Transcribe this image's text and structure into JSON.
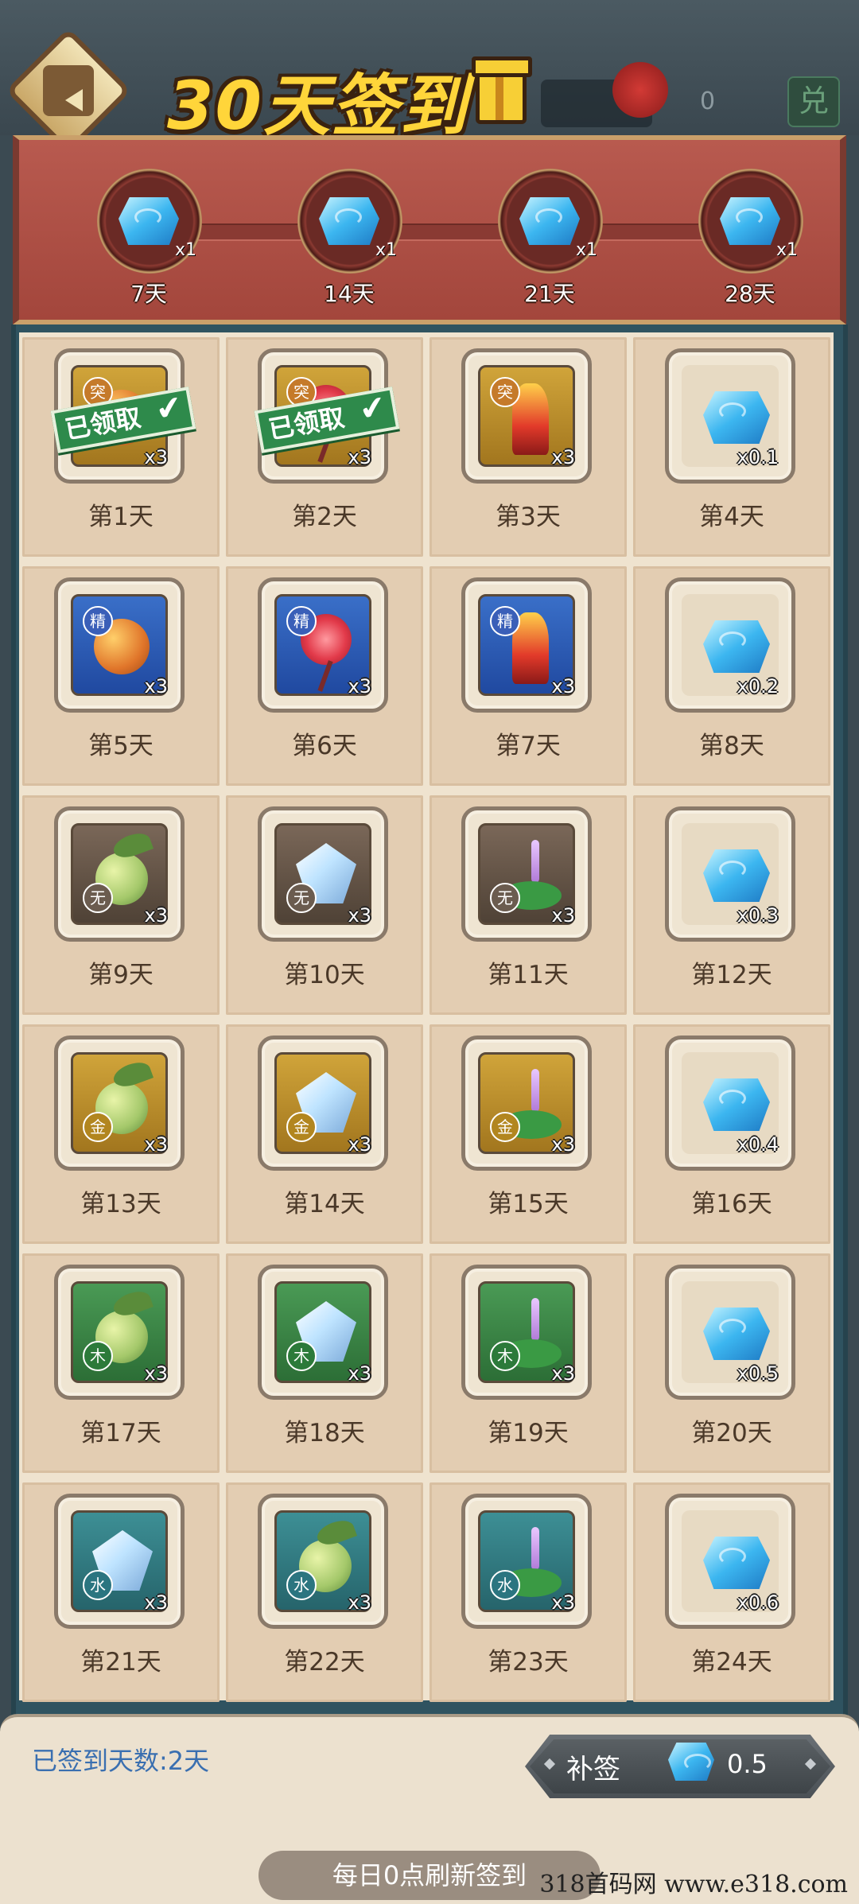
{
  "header": {
    "title": "30天签到",
    "currency_value": "0",
    "exchange_label": "兑"
  },
  "milestones": [
    {
      "count": "x1",
      "label": "7天",
      "icon": "blue-gem-icon"
    },
    {
      "count": "x1",
      "label": "14天",
      "icon": "blue-gem-icon"
    },
    {
      "count": "x1",
      "label": "21天",
      "icon": "blue-gem-icon"
    },
    {
      "count": "x1",
      "label": "28天",
      "icon": "blue-gem-icon"
    }
  ],
  "claimed_label": "已领取",
  "days": [
    {
      "label": "第1天",
      "qty": "x3",
      "bg": "gold",
      "badge": "突",
      "badge_pos": "top",
      "item": "orb",
      "claimed": true
    },
    {
      "label": "第2天",
      "qty": "x3",
      "bg": "gold",
      "badge": "突",
      "badge_pos": "top",
      "item": "flower",
      "claimed": true
    },
    {
      "label": "第3天",
      "qty": "x3",
      "bg": "gold",
      "badge": "突",
      "badge_pos": "top",
      "item": "coral",
      "claimed": false
    },
    {
      "label": "第4天",
      "qty": "x0.1",
      "bg": "plain",
      "badge": "",
      "item": "gem",
      "claimed": false
    },
    {
      "label": "第5天",
      "qty": "x3",
      "bg": "blue",
      "badge": "精",
      "badge_pos": "top",
      "item": "orb",
      "claimed": false
    },
    {
      "label": "第6天",
      "qty": "x3",
      "bg": "blue",
      "badge": "精",
      "badge_pos": "top",
      "item": "flower",
      "claimed": false
    },
    {
      "label": "第7天",
      "qty": "x3",
      "bg": "blue",
      "badge": "精",
      "badge_pos": "top",
      "item": "coral",
      "claimed": false
    },
    {
      "label": "第8天",
      "qty": "x0.2",
      "bg": "plain",
      "badge": "",
      "item": "gem",
      "claimed": false
    },
    {
      "label": "第9天",
      "qty": "x3",
      "bg": "brown",
      "badge": "无",
      "badge_pos": "bot",
      "item": "orb-green",
      "claimed": false
    },
    {
      "label": "第10天",
      "qty": "x3",
      "bg": "brown",
      "badge": "无",
      "badge_pos": "bot",
      "item": "crystal",
      "claimed": false
    },
    {
      "label": "第11天",
      "qty": "x3",
      "bg": "brown",
      "badge": "无",
      "badge_pos": "bot",
      "item": "plant",
      "claimed": false
    },
    {
      "label": "第12天",
      "qty": "x0.3",
      "bg": "plain",
      "badge": "",
      "item": "gem",
      "claimed": false
    },
    {
      "label": "第13天",
      "qty": "x3",
      "bg": "gold",
      "badge": "金",
      "badge_pos": "bot",
      "item": "orb-green",
      "claimed": false
    },
    {
      "label": "第14天",
      "qty": "x3",
      "bg": "gold",
      "badge": "金",
      "badge_pos": "bot",
      "item": "crystal",
      "claimed": false
    },
    {
      "label": "第15天",
      "qty": "x3",
      "bg": "gold",
      "badge": "金",
      "badge_pos": "bot",
      "item": "plant",
      "claimed": false
    },
    {
      "label": "第16天",
      "qty": "x0.4",
      "bg": "plain",
      "badge": "",
      "item": "gem",
      "claimed": false
    },
    {
      "label": "第17天",
      "qty": "x3",
      "bg": "green",
      "badge": "木",
      "badge_pos": "bot",
      "item": "orb-green",
      "claimed": false
    },
    {
      "label": "第18天",
      "qty": "x3",
      "bg": "green",
      "badge": "木",
      "badge_pos": "bot",
      "item": "crystal",
      "claimed": false
    },
    {
      "label": "第19天",
      "qty": "x3",
      "bg": "green",
      "badge": "木",
      "badge_pos": "bot",
      "item": "plant",
      "claimed": false
    },
    {
      "label": "第20天",
      "qty": "x0.5",
      "bg": "plain",
      "badge": "",
      "item": "gem",
      "claimed": false
    },
    {
      "label": "第21天",
      "qty": "x3",
      "bg": "teal",
      "badge": "水",
      "badge_pos": "bot",
      "item": "crystal",
      "claimed": false
    },
    {
      "label": "第22天",
      "qty": "x3",
      "bg": "teal",
      "badge": "水",
      "badge_pos": "bot",
      "item": "orb-green",
      "claimed": false
    },
    {
      "label": "第23天",
      "qty": "x3",
      "bg": "teal",
      "badge": "水",
      "badge_pos": "bot",
      "item": "plant",
      "claimed": false
    },
    {
      "label": "第24天",
      "qty": "x0.6",
      "bg": "plain",
      "badge": "",
      "item": "gem",
      "claimed": false
    }
  ],
  "footer": {
    "signed_days": "已签到天数:2天",
    "makeup_label": "补签",
    "makeup_cost": "0.5",
    "refresh_note": "每日0点刷新签到"
  },
  "watermark": "318首码网  www.e318.com"
}
